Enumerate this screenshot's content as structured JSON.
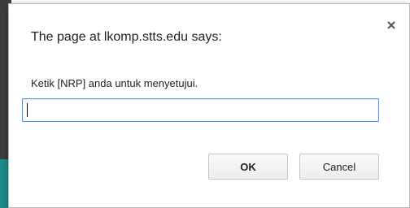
{
  "dialog": {
    "title": "The page at lkomp.stts.edu says:",
    "message": "Ketik [NRP] anda untuk menyetujui.",
    "input_value": "",
    "ok_label": "OK",
    "cancel_label": "Cancel",
    "close_icon": "close-icon"
  },
  "colors": {
    "focus_border": "#4d90fe",
    "background_teal": "#1c8c8c"
  }
}
